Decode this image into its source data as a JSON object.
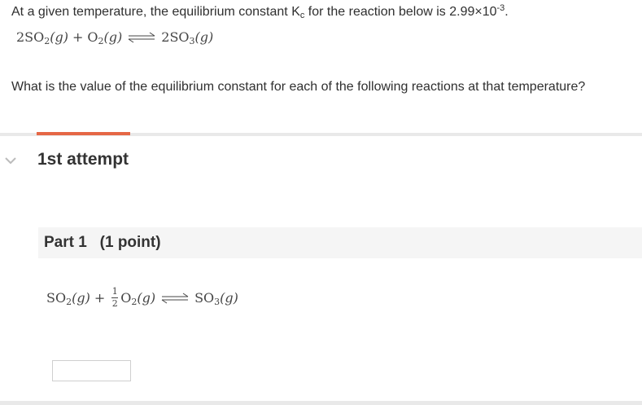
{
  "question": {
    "prefix": "At a given temperature, the equilibrium constant K",
    "k_subscript": "c",
    "mid": " for the reaction below is 2.99×10",
    "exponent": "-3",
    "suffix": ".",
    "prompt": "What is the value of the equilibrium constant for each of the following reactions at that temperature?"
  },
  "reaction_main": {
    "r1_coef": "2SO",
    "r1_sub": "2",
    "r1_state": "(g)",
    "plus": "+",
    "r2": "O",
    "r2_sub": "2",
    "r2_state": "(g)",
    "p1_coef": "2SO",
    "p1_sub": "3",
    "p1_state": "(g)"
  },
  "attempt": {
    "title": "1st attempt",
    "accent_color": "#e56745",
    "chevron_icon": "chevron-down-icon"
  },
  "part1": {
    "title": "Part 1   (1 point)",
    "reaction": {
      "r1": "SO",
      "r1_sub": "2",
      "r1_state": "(g)",
      "plus": "+",
      "frac_num": "1",
      "frac_den": "2",
      "r2": "O",
      "r2_sub": "2",
      "r2_state": "(g)",
      "p1": "SO",
      "p1_sub": "3",
      "p1_state": "(g)"
    },
    "answer_value": ""
  }
}
